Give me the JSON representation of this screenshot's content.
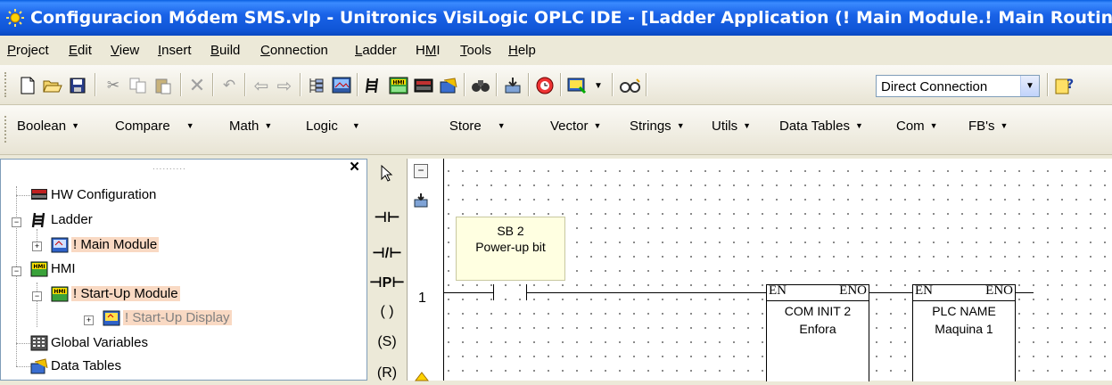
{
  "window": {
    "title": "Configuracion Módem SMS.vlp - Unitronics VisiLogic OPLC IDE - [Ladder Application (! Main Module.! Main Routine)]"
  },
  "menu": [
    {
      "label": "Project",
      "u": "P",
      "rest": "roject"
    },
    {
      "label": "Edit",
      "u": "E",
      "rest": "dit"
    },
    {
      "label": "View",
      "u": "V",
      "rest": "iew"
    },
    {
      "label": "Insert",
      "u": "I",
      "rest": "nsert"
    },
    {
      "label": "Build",
      "u": "B",
      "rest": "uild"
    },
    {
      "label": "Connection",
      "u": "C",
      "rest": "onnection"
    },
    {
      "label": "Ladder",
      "u": "L",
      "rest": "adder"
    },
    {
      "label": "HMI",
      "u": "H",
      "pre": "H",
      "mid": "M",
      "post": "I"
    },
    {
      "label": "Tools",
      "u": "T",
      "rest": "ools"
    },
    {
      "label": "Help",
      "u": "H",
      "rest": "elp"
    }
  ],
  "toolbar": {
    "connection_combo": "Direct Connection"
  },
  "element_bar": {
    "items": [
      "Boolean",
      "Compare",
      "Math",
      "Logic",
      "Store",
      "Vector",
      "Strings",
      "Utils",
      "Data Tables",
      "Com",
      "FB's"
    ]
  },
  "tree": {
    "items": [
      {
        "label": "HW Configuration"
      },
      {
        "label": "Ladder"
      },
      {
        "label": "! Main Module"
      },
      {
        "label": "HMI"
      },
      {
        "label": "! Start-Up Module"
      },
      {
        "label": "! Start-Up Display"
      },
      {
        "label": "Global Variables"
      },
      {
        "label": "Data Tables"
      }
    ]
  },
  "palette": {
    "items": [
      "⊣⊢",
      "⊣/⊢",
      "⊣P⊢",
      "( )",
      "(S)",
      "(R)"
    ]
  },
  "ladder": {
    "rung_number": "1",
    "comment_line1": "SB 2",
    "comment_line2": "Power-up bit",
    "blocks": [
      {
        "en": "EN",
        "eno": "ENO",
        "name": "COM INIT 2",
        "param": "Enfora"
      },
      {
        "en": "EN",
        "eno": "ENO",
        "name": "PLC NAME",
        "param": "Maquina 1"
      }
    ]
  }
}
